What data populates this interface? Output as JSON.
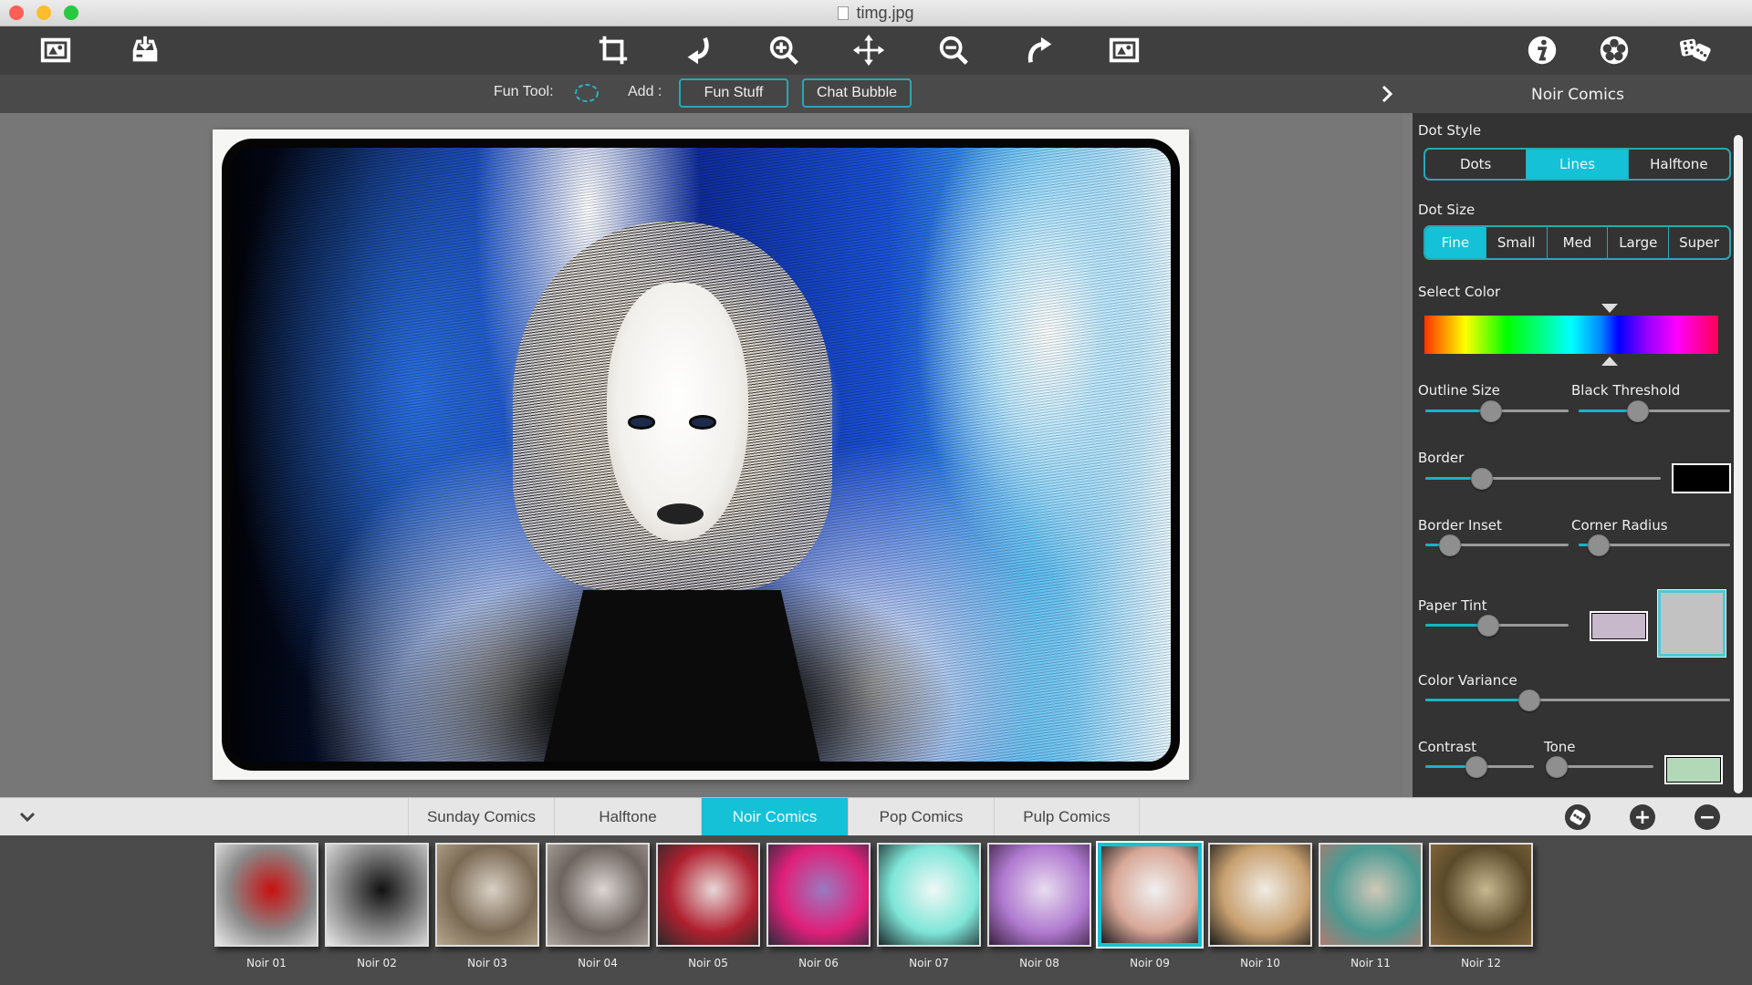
{
  "window": {
    "title": "timg.jpg",
    "traffic_lights": {
      "close": "#fe5f57",
      "minimize": "#febc2e",
      "maximize": "#28c840"
    }
  },
  "toolbar": {
    "left_icons": [
      "open-image-icon",
      "save-download-icon"
    ],
    "center_icons": [
      "crop-icon",
      "rotate-left-icon",
      "zoom-in-icon",
      "move-icon",
      "zoom-out-icon",
      "rotate-right-icon",
      "fit-image-icon"
    ],
    "right_icons": [
      "info-icon",
      "settings-flower-icon",
      "dice-random-icon"
    ]
  },
  "subbar": {
    "fun_tool_label": "Fun Tool:",
    "fun_tool_icon": "ellipse-select-icon",
    "add_label": "Add :",
    "fun_stuff_button": "Fun Stuff",
    "chat_bubble_button": "Chat Bubble",
    "collapse_chevron": "chevron-right-icon",
    "panel_title": "Noir Comics"
  },
  "panel": {
    "dot_style": {
      "label": "Dot Style",
      "options": [
        "Dots",
        "Lines",
        "Halftone"
      ],
      "selected": "Lines"
    },
    "dot_size": {
      "label": "Dot Size",
      "options": [
        "Fine",
        "Small",
        "Med",
        "Large",
        "Super"
      ],
      "selected": "Fine"
    },
    "select_color": {
      "label": "Select Color",
      "hue_position": 0.63
    },
    "outline_size": {
      "label": "Outline Size",
      "value": 0.46
    },
    "black_threshold": {
      "label": "Black Threshold",
      "value": 0.39
    },
    "border": {
      "label": "Border",
      "value": 0.24,
      "color": "#000000"
    },
    "border_inset": {
      "label": "Border Inset",
      "value": 0.17
    },
    "corner_radius": {
      "label": "Corner Radius",
      "value": 0.13
    },
    "paper_tint": {
      "label": "Paper Tint",
      "value": 0.44,
      "tint_color": "#c8b8cc",
      "paper_color": "#c2c2c2"
    },
    "color_variance": {
      "label": "Color Variance",
      "value": 0.34
    },
    "contrast": {
      "label": "Contrast",
      "value": 0.47
    },
    "tone": {
      "label": "Tone",
      "value": 0.09,
      "color": "#b2d8b8"
    }
  },
  "tabs": {
    "collapse_icon": "chevron-down-icon",
    "items": [
      "Sunday Comics",
      "Halftone",
      "Noir Comics",
      "Pop Comics",
      "Pulp Comics"
    ],
    "active": "Noir Comics",
    "actions": [
      "random-dice-icon",
      "add-preset-icon",
      "remove-preset-icon"
    ],
    "add_symbol": "+",
    "remove_symbol": "−"
  },
  "presets": {
    "selected": "Noir 09",
    "items": [
      {
        "label": "Noir 01",
        "colors": [
          "#e8e8e8",
          "#8a8a8a",
          "#c81010"
        ]
      },
      {
        "label": "Noir 02",
        "colors": [
          "#e8e8e8",
          "#8a8a8a",
          "#111111"
        ]
      },
      {
        "label": "Noir 03",
        "colors": [
          "#b8a78c",
          "#7a6a55",
          "#d9d0c4"
        ]
      },
      {
        "label": "Noir 04",
        "colors": [
          "#b0a7a0",
          "#6e6460",
          "#dcd6d2"
        ]
      },
      {
        "label": "Noir 05",
        "colors": [
          "#2a2a2a",
          "#b02030",
          "#e8d8d8"
        ]
      },
      {
        "label": "Noir 06",
        "colors": [
          "#2a2a3a",
          "#e0207a",
          "#9a7ac0"
        ]
      },
      {
        "label": "Noir 07",
        "colors": [
          "#1a2a2a",
          "#7fe6d8",
          "#f0f8f6"
        ]
      },
      {
        "label": "Noir 08",
        "colors": [
          "#3a2040",
          "#b07ad0",
          "#e8dcef"
        ]
      },
      {
        "label": "Noir 09",
        "colors": [
          "#1a1a1a",
          "#d8a898",
          "#f0f0f0"
        ]
      },
      {
        "label": "Noir 10",
        "colors": [
          "#1a1a1a",
          "#c8a070",
          "#f0ece4"
        ]
      },
      {
        "label": "Noir 11",
        "colors": [
          "#b07a70",
          "#4a9a92",
          "#d0c8b8"
        ]
      },
      {
        "label": "Noir 12",
        "colors": [
          "#8a6a40",
          "#5a4a2a",
          "#c8b890"
        ]
      }
    ]
  },
  "colors": {
    "accent": "#14c1d6",
    "accent_border": "#2aa7b5",
    "toolbar_bg": "#3f3f3f",
    "panel_bg": "#333333",
    "canvas_bg": "#777777"
  }
}
